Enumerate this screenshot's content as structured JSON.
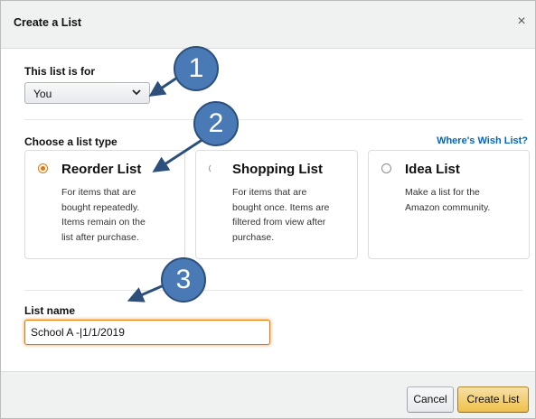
{
  "dialog": {
    "title": "Create a List",
    "close": "×"
  },
  "list_for": {
    "label": "This list is for",
    "selected": "You"
  },
  "list_type": {
    "label": "Choose a list type",
    "wish_link": "Where's Wish List?",
    "cards": [
      {
        "title": "Reorder List",
        "lines": [
          "For items that are",
          "bought repeatedly.",
          "Items remain on the",
          "list after purchase."
        ],
        "selected": true
      },
      {
        "title": "Shopping List",
        "lines": [
          "For items that are",
          "bought once. Items are",
          "filtered from view after",
          "purchase."
        ],
        "selected": false
      },
      {
        "title": "Idea List",
        "lines": [
          "Make a list for the",
          "Amazon community."
        ],
        "selected": false
      }
    ]
  },
  "list_name": {
    "label": "List name",
    "value": "School A -|1/1/2019"
  },
  "footer": {
    "cancel": "Cancel",
    "create": "Create List"
  },
  "callouts": [
    "1",
    "2",
    "3"
  ],
  "colors": {
    "accent": "#e77600",
    "link": "#0066c0",
    "callout": "#4a7ab5",
    "primary_button": "#f0c14b"
  }
}
